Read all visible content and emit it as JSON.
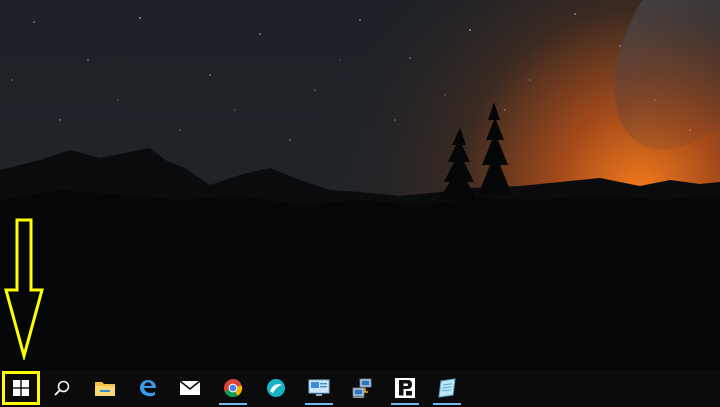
{
  "desktop": {
    "wallpaper": "night-sky-mountain-silhouette",
    "annotation": "yellow-down-arrow-highlight"
  },
  "taskbar": {
    "start": {
      "icon": "windows-logo-icon",
      "highlight_color": "#ffff00"
    },
    "search": {
      "icon": "search-icon"
    },
    "pinned": [
      {
        "name": "file-explorer-icon"
      },
      {
        "name": "edge-icon"
      },
      {
        "name": "mail-icon"
      },
      {
        "name": "chrome-icon"
      },
      {
        "name": "app-teal-swirl-icon"
      },
      {
        "name": "remote-desktop-icon"
      },
      {
        "name": "network-connections-icon"
      },
      {
        "name": "app-p-icon"
      },
      {
        "name": "notepad-icon"
      }
    ]
  },
  "colors": {
    "accent": "#76b9ed",
    "glow": "#e06a1a",
    "taskbar": "#0b0b0b"
  }
}
